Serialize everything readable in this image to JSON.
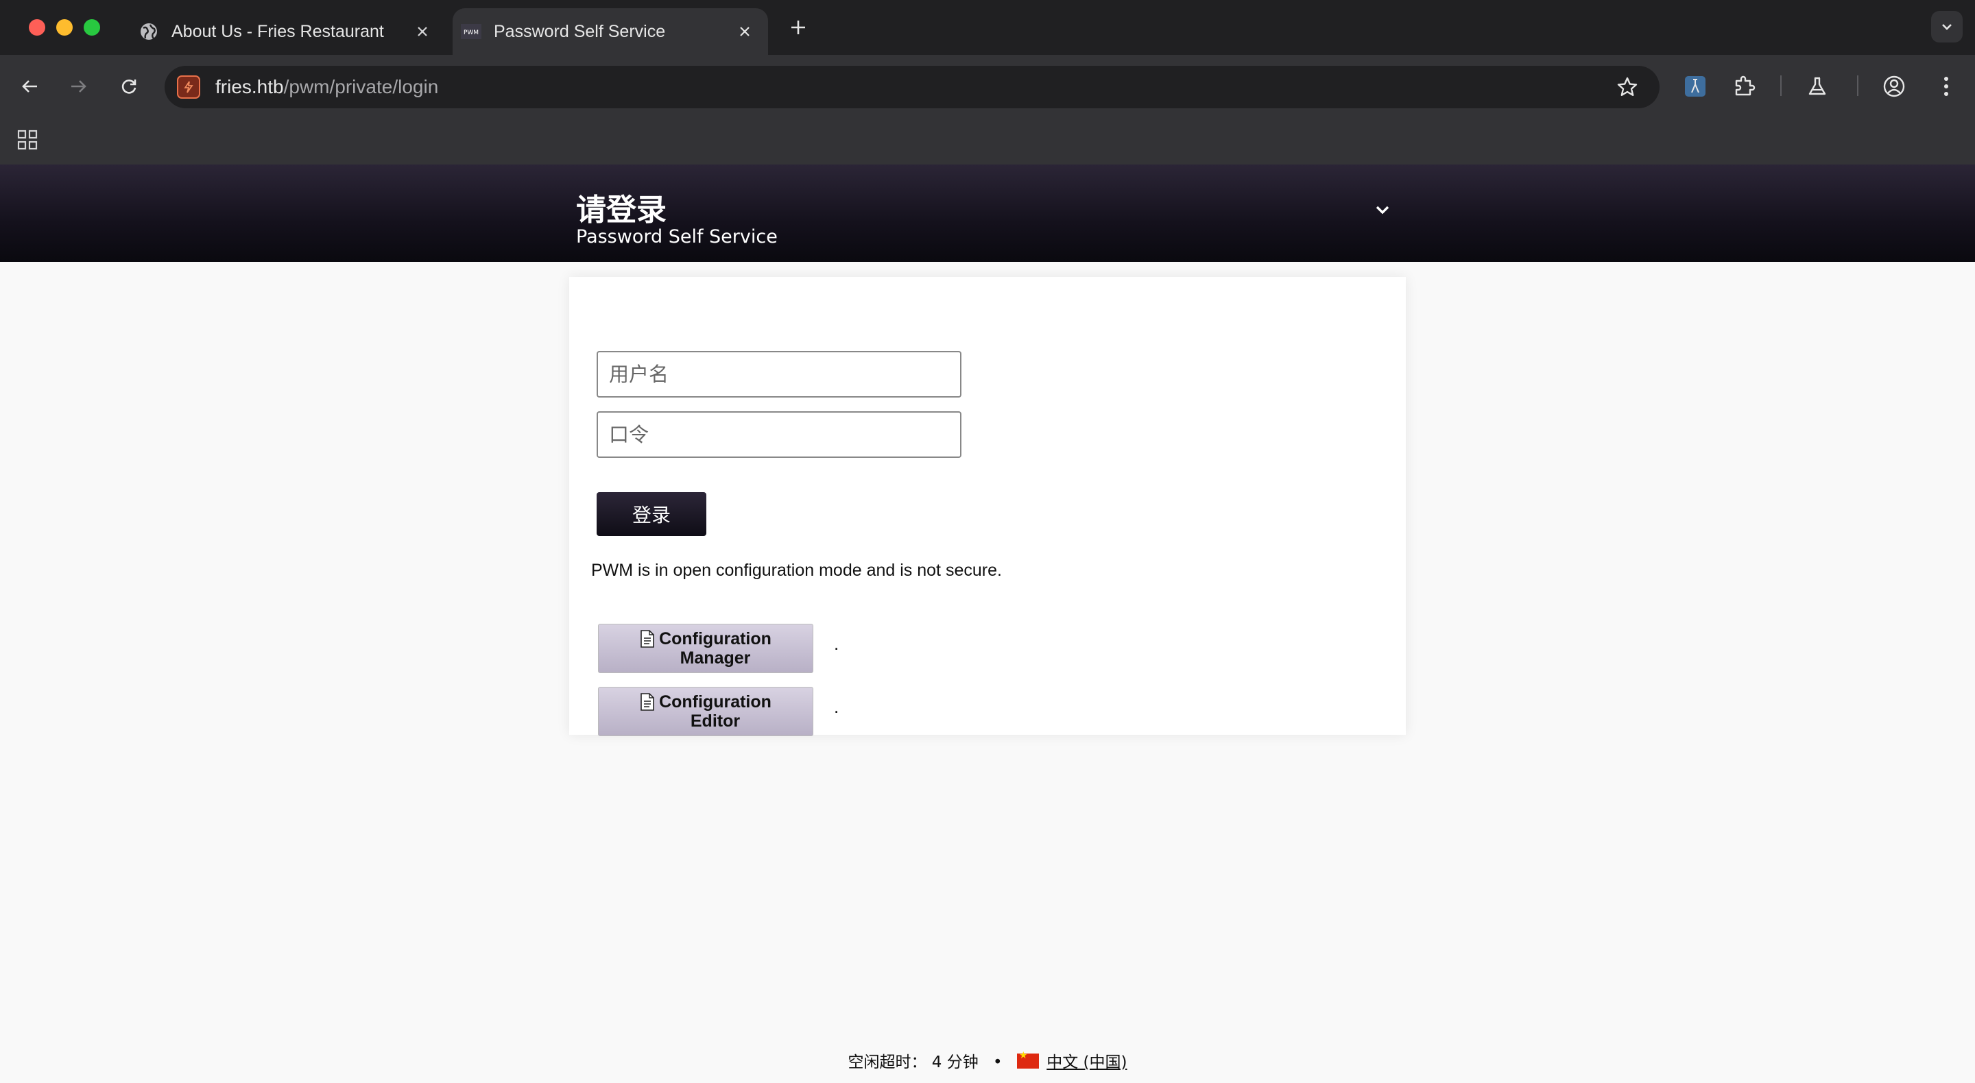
{
  "browser": {
    "tabs": [
      {
        "title": "About Us - Fries Restaurant",
        "icon": "globe-icon",
        "active": false
      },
      {
        "title": "Password Self Service",
        "icon": "pwm-favicon",
        "favicon_text": "PWM",
        "active": true
      }
    ],
    "url_host": "fries.htb",
    "url_path": "/pwm/private/login"
  },
  "header": {
    "title": "请登录",
    "subtitle": "Password Self Service"
  },
  "login": {
    "username_placeholder": "用户名",
    "password_placeholder": "口令",
    "login_label": "登录"
  },
  "config": {
    "note": "PWM is in open configuration mode and is not secure.",
    "manager_line1": "Configuration",
    "manager_line2": "Manager",
    "editor_line1": "Configuration",
    "editor_line2": "Editor",
    "trailing_dot": "."
  },
  "footer": {
    "idle_timeout": "空闲超时：  4 分钟",
    "separator": "•",
    "language": "中文 (中国)"
  },
  "colors": {
    "header_bg": "#14111c",
    "config_button_bg": "#c9c1d6",
    "login_button_bg": "#1a1622"
  }
}
